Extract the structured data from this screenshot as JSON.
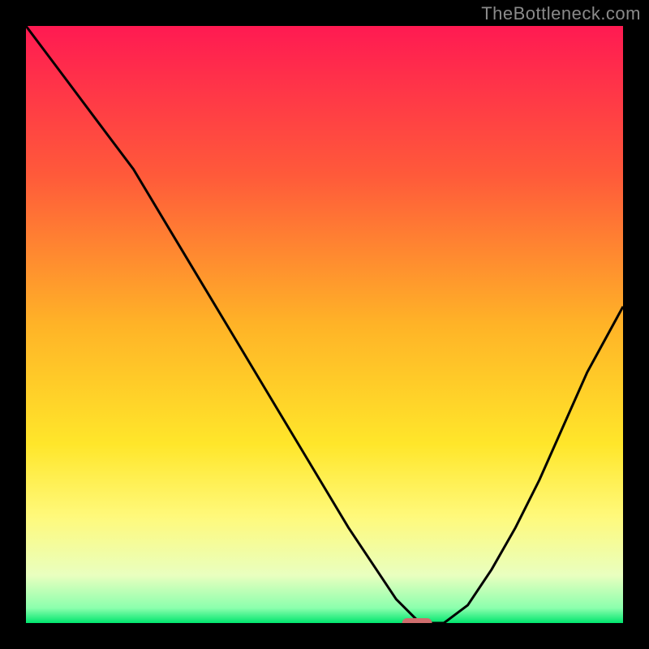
{
  "watermark": "TheBottleneck.com",
  "chart_data": {
    "type": "line",
    "title": "",
    "xlabel": "",
    "ylabel": "",
    "xlim": [
      0,
      100
    ],
    "ylim": [
      0,
      100
    ],
    "grid": false,
    "axes_visible": false,
    "background": {
      "style": "vertical-gradient",
      "stops": [
        {
          "pos": 0.0,
          "color": "#ff1a52"
        },
        {
          "pos": 0.25,
          "color": "#ff5a3a"
        },
        {
          "pos": 0.5,
          "color": "#ffb327"
        },
        {
          "pos": 0.7,
          "color": "#ffe62a"
        },
        {
          "pos": 0.82,
          "color": "#fff97a"
        },
        {
          "pos": 0.92,
          "color": "#e9ffbf"
        },
        {
          "pos": 0.975,
          "color": "#8bffad"
        },
        {
          "pos": 1.0,
          "color": "#00e56e"
        }
      ]
    },
    "series": [
      {
        "name": "bottleneck-curve",
        "color": "#000000",
        "width": 3,
        "x": [
          0,
          6,
          12,
          18,
          24,
          30,
          36,
          42,
          48,
          54,
          58,
          62,
          66,
          70,
          74,
          78,
          82,
          86,
          90,
          94,
          100
        ],
        "y": [
          100,
          92,
          84,
          76,
          66,
          56,
          46,
          36,
          26,
          16,
          10,
          4,
          0,
          0,
          3,
          9,
          16,
          24,
          33,
          42,
          53
        ]
      }
    ],
    "marker": {
      "name": "optimal-point",
      "x_range": [
        63,
        68
      ],
      "y": 0,
      "color": "#cf6d6d",
      "shape": "capsule"
    }
  }
}
